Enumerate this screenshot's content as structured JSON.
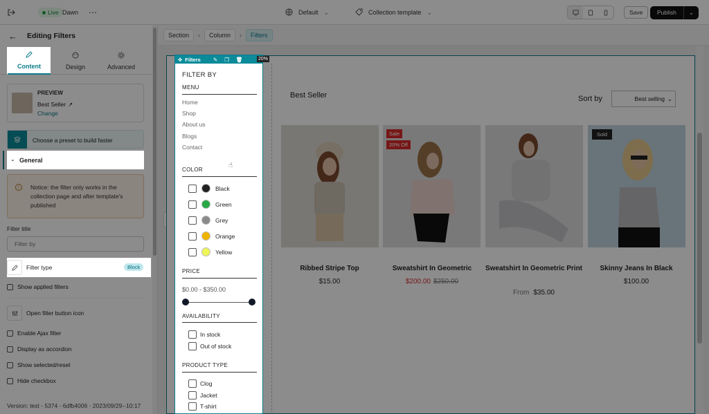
{
  "topbar": {
    "live_label": "Live",
    "theme_name": "Dawn",
    "more_icon": "ellipsis-icon",
    "locale": "Default",
    "template": "Collection template",
    "save_label": "Save",
    "publish_label": "Publish"
  },
  "panel": {
    "title": "Editing Filters",
    "tabs": [
      {
        "label": "Content",
        "icon": "pencil-icon"
      },
      {
        "label": "Design",
        "icon": "palette-icon"
      },
      {
        "label": "Advanced",
        "icon": "gear-icon"
      }
    ],
    "preview": {
      "heading": "PREVIEW",
      "name": "Best Seller",
      "change_label": "Change"
    },
    "preset_label": "Choose a preset to build faster",
    "general_label": "General",
    "notice": "Notice: the filter only works in the collection page and after template's published",
    "filter_title_label": "Filter title",
    "filter_title_placeholder": "Filter by",
    "filter_type_label": "Filter type",
    "filter_type_badge": "Block",
    "show_applied": "Show applied filters",
    "open_filter_icon": "Open filter button icon",
    "enable_ajax": "Enable Ajax filter",
    "accordion": "Display as accordion",
    "show_selected": "Show selected/reset",
    "hide_checkbox": "Hide checkbox",
    "version": "Version: test - 5374 - 6dfb4006 - 2023/09/29--10:17"
  },
  "breadcrumb": [
    "Section",
    "Column",
    "Filters"
  ],
  "filters": {
    "toolbar_label": "Filters",
    "width_badge": "20%",
    "filter_by": "FILTER BY",
    "menu_heading": "MENU",
    "menu_items": [
      "Home",
      "Shop",
      "About us",
      "Blogs",
      "Contact"
    ],
    "color_heading": "COLOR",
    "colors": [
      {
        "name": "Black",
        "hex": "#222222"
      },
      {
        "name": "Green",
        "hex": "#27a845"
      },
      {
        "name": "Grey",
        "hex": "#8a8a8a"
      },
      {
        "name": "Orange",
        "hex": "#f0b400"
      },
      {
        "name": "Yellow",
        "hex": "#eef55a"
      }
    ],
    "price_heading": "PRICE",
    "price_range": "$0.00 - $350.00",
    "availability_heading": "AVAILABILITY",
    "availability": [
      "In stock",
      "Out of stock"
    ],
    "product_type_heading": "PRODUCT TYPE",
    "product_types": [
      "Clog",
      "Jacket",
      "T-shirt"
    ]
  },
  "collection": {
    "title": "Best Seller",
    "sort_label": "Sort by",
    "sort_value": "Best selling",
    "products": [
      {
        "title": "Ribbed Stripe Top",
        "price": "$15.00"
      },
      {
        "title": "Sweatshirt In Geometric",
        "sale_price": "$200.00",
        "compare_price": "$250.00",
        "badges": [
          "Sale",
          "20% Off"
        ]
      },
      {
        "title": "Sweatshirt In Geometric Print",
        "from_label": "From",
        "price": "$35.00"
      },
      {
        "title": "Skinny Jeans In Black",
        "price": "$100.00",
        "badges": [
          "Sold"
        ]
      }
    ]
  },
  "colors": {
    "accent": "#0b7b8b",
    "sale_red": "#d92a2a"
  }
}
